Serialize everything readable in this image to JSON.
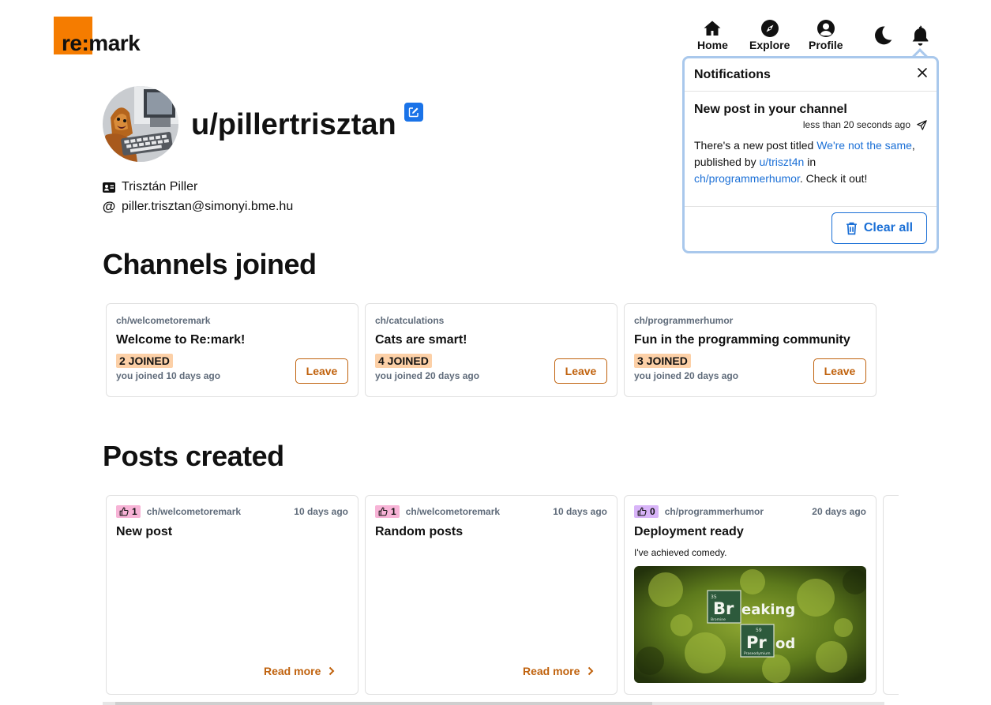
{
  "logo": {
    "text": "re:mark"
  },
  "nav": {
    "home": "Home",
    "explore": "Explore",
    "profile": "Profile"
  },
  "notifications": {
    "title": "Notifications",
    "item": {
      "title": "New post in your channel",
      "time": "less than 20 seconds ago",
      "text_1": "There's a new post titled ",
      "post_link": "We're not the same",
      "text_2": ", published by ",
      "user_link": "u/triszt4n",
      "text_3": " in ",
      "channel_link": "ch/programmerhumor",
      "text_4": ". Check it out!"
    },
    "clear_all": "Clear all"
  },
  "profile": {
    "username": "u/pillertrisztan",
    "full_name": "Trisztán Piller",
    "email": "piller.trisztan@simonyi.bme.hu"
  },
  "channels_section": {
    "title": "Channels joined",
    "channels": [
      {
        "name": "ch/welcometoremark",
        "title": "Welcome to Re:mark!",
        "members": "2 JOINED",
        "joined": "you joined 10 days ago",
        "action": "Leave"
      },
      {
        "name": "ch/catculations",
        "title": "Cats are smart!",
        "members": "4 JOINED",
        "joined": "you joined 20 days ago",
        "action": "Leave"
      },
      {
        "name": "ch/programmerhumor",
        "title": "Fun in the programming community",
        "members": "3 JOINED",
        "joined": "you joined 20 days ago",
        "action": "Leave"
      }
    ]
  },
  "posts_section": {
    "title": "Posts created",
    "posts": [
      {
        "likes": "1",
        "channel": "ch/welcometoremark",
        "date": "10 days ago",
        "title": "New post",
        "read_more": "Read more"
      },
      {
        "likes": "1",
        "channel": "ch/welcometoremark",
        "date": "10 days ago",
        "title": "Random posts",
        "read_more": "Read more"
      },
      {
        "likes": "0",
        "channel": "ch/programmerhumor",
        "date": "20 days ago",
        "title": "Deployment ready",
        "description": "I've achieved comedy."
      }
    ]
  },
  "image": {
    "el1_num": "35",
    "el1_sym": "Br",
    "el1_name": "Bromine",
    "word1": "eaking",
    "el2_num": "59",
    "el2_sym": "Pr",
    "el2_name": "Praseodymium",
    "word2": "od"
  },
  "colors": {
    "brand_orange": "#f57c00",
    "link_blue": "#1a6fd6",
    "action_orange": "#c0620d",
    "badge_peach": "#fcd0a7",
    "like_pink": "#f7b3d6",
    "like_purple": "#d8b4f8"
  },
  "icons": [
    "home-icon",
    "compass-icon",
    "user-circle-icon",
    "moon-icon",
    "bell-icon",
    "close-icon",
    "send-icon",
    "trash-icon",
    "edit-icon",
    "id-card-icon",
    "at-icon",
    "thumbs-up-icon",
    "chevron-right-icon"
  ]
}
